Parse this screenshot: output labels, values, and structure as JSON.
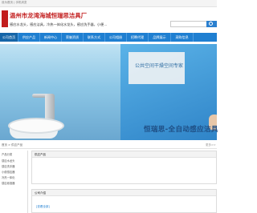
{
  "topbar": {
    "links": "设为首页 | 手机浏览"
  },
  "header": {
    "company_name": "温州市龙湾海城恒瑞思洁具厂",
    "keywords": "感应水龙头，感应洁具，冷热一体化水龙头，感应洗手器，小便...",
    "search": {
      "placeholder": ""
    }
  },
  "nav": {
    "items": [
      {
        "label": "公司首页"
      },
      {
        "label": "供应产品"
      },
      {
        "label": "新闻中心"
      },
      {
        "label": "荣誉资质"
      },
      {
        "label": "联系方式"
      },
      {
        "label": "公司相册"
      },
      {
        "label": "招聘代理"
      },
      {
        "label": "品牌展示"
      },
      {
        "label": "采购信息"
      }
    ]
  },
  "banner": {
    "slogan_1": "公共空间干燥空间专家",
    "slogan_2": "恒瑞思-全自动感应洁具"
  },
  "breadcrumb": {
    "text": "首页 > 供应产品",
    "more": "更多>>"
  },
  "sidebar": {
    "items": [
      {
        "label": "产品分类"
      },
      {
        "label": "感应水龙头"
      },
      {
        "label": "感应洗手器"
      },
      {
        "label": "小便感应器"
      },
      {
        "label": "冷热一体化"
      },
      {
        "label": "感应皂液器"
      }
    ]
  },
  "panels": {
    "products": {
      "title": "供应产品"
    },
    "intro": {
      "title": "公司介绍",
      "link": "[查看全部]"
    }
  }
}
